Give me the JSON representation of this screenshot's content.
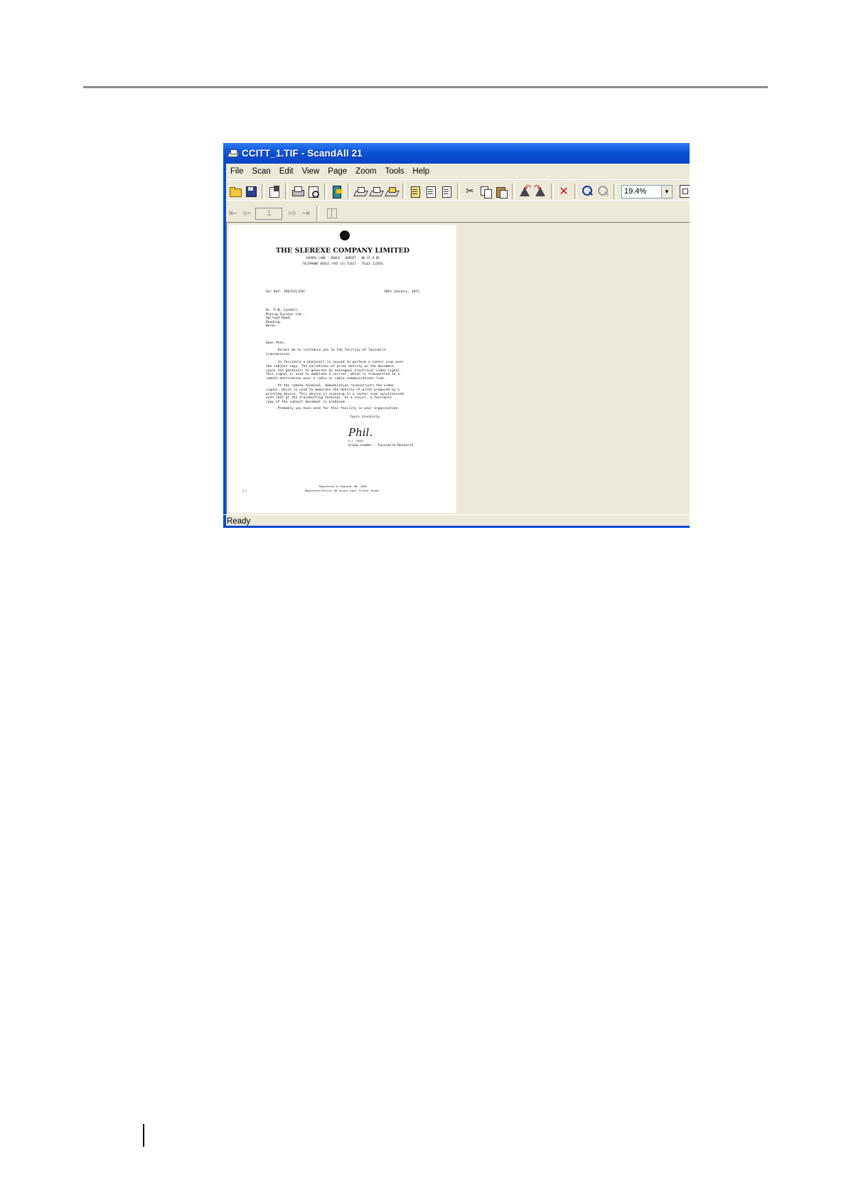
{
  "window": {
    "title": "CCITT_1.TIF - ScandAll 21"
  },
  "menu": [
    "File",
    "Scan",
    "Edit",
    "View",
    "Page",
    "Zoom",
    "Tools",
    "Help"
  ],
  "toolbar": {
    "zoom_value": "19.4%"
  },
  "page_nav": {
    "page_number": "1"
  },
  "status": {
    "text": "Ready"
  },
  "icons": {
    "app": "scanner-icon",
    "open": "open-folder-icon",
    "save": "save-icon",
    "properties": "properties-icon",
    "print": "print-icon",
    "print_preview": "print-preview-icon",
    "exit": "exit-icon",
    "delete": "delete-icon",
    "zoom_in": "zoom-in-icon",
    "zoom_out": "zoom-out-icon"
  },
  "colors": {
    "titlebar": "#0a53d8",
    "window_bg": "#ece9d8",
    "delete": "#c01818"
  },
  "document": {
    "letterhead": "THE SLEREXE COMPANY LIMITED",
    "sub1": "SAPORS LANE · BOOLE · DORSET · BH 25 8 ER",
    "sub2": "TELEPHONE BOOLE (945 13) 51617 · TELEX 123456",
    "ref": "Our Ref. 350/PJC/EAC",
    "date": "18th January, 1972.",
    "address": "Dr. P.N. Cundall,\nMining Surveys Ltd.,\nHolroyd Road,\nReading,\nBerks.",
    "salutation": "Dear Pete,",
    "p1": "      Permit me to introduce you to the facility of facsimile\ntransmission.",
    "p2": "      In facsimile a photocell is caused to perform a raster scan over\nthe subject copy. The variations of print density on the document\ncause the photocell to generate an analogous electrical video signal.\nThis signal is used to modulate a carrier, which is transmitted to a\nremote destination over a radio or cable communications link.",
    "p3": "      At the remote terminal, demodulation reconstructs the video\nsignal, which is used to modulate the density of print produced by a\nprinting device. This device is scanning in a raster scan synchronised\nwith that at the transmitting terminal. As a result, a facsimile\ncopy of the subject document is produced.",
    "p4": "      Probably you have uses for this facility in your organisation.",
    "closing": "Yours sincerely,",
    "signature": "Phil.",
    "signer_name": "P.J. CROSS",
    "signer_title": "Group Leader - Facsimile Research",
    "footer1": "Registered in England: No. 2038",
    "footer2": "Registered Office: 60 Vicara Lane, Ilford. Essex.",
    "page_mark": "S-1"
  }
}
